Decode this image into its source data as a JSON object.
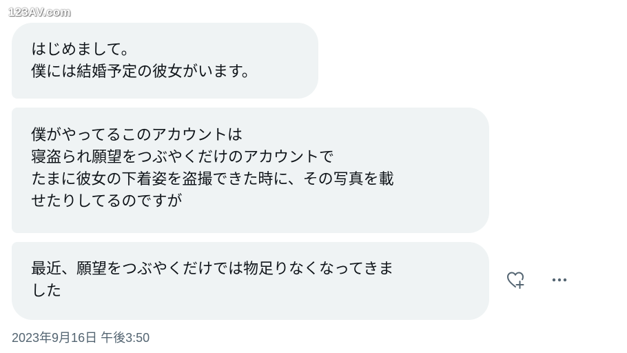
{
  "watermark": "123AV.com",
  "messages": [
    {
      "text": "はじめまして。\n僕には結婚予定の彼女がいます。"
    },
    {
      "text": "僕がやってるこのアカウントは\n寝盗られ願望をつぶやくだけのアカウントで\nたまに彼女の下着姿を盗撮できた時に、その写真を載\nせたりしてるのですが"
    },
    {
      "text": "最近、願望をつぶやくだけでは物足りなくなってきま\nした"
    }
  ],
  "actions": {
    "react_icon": "heart-plus-icon",
    "more_icon": "more-horizontal-icon"
  },
  "timestamp": "2023年9月16日 午後3:50",
  "colors": {
    "bubble_bg": "#eff3f4",
    "text": "#0f1419",
    "secondary": "#536471"
  }
}
